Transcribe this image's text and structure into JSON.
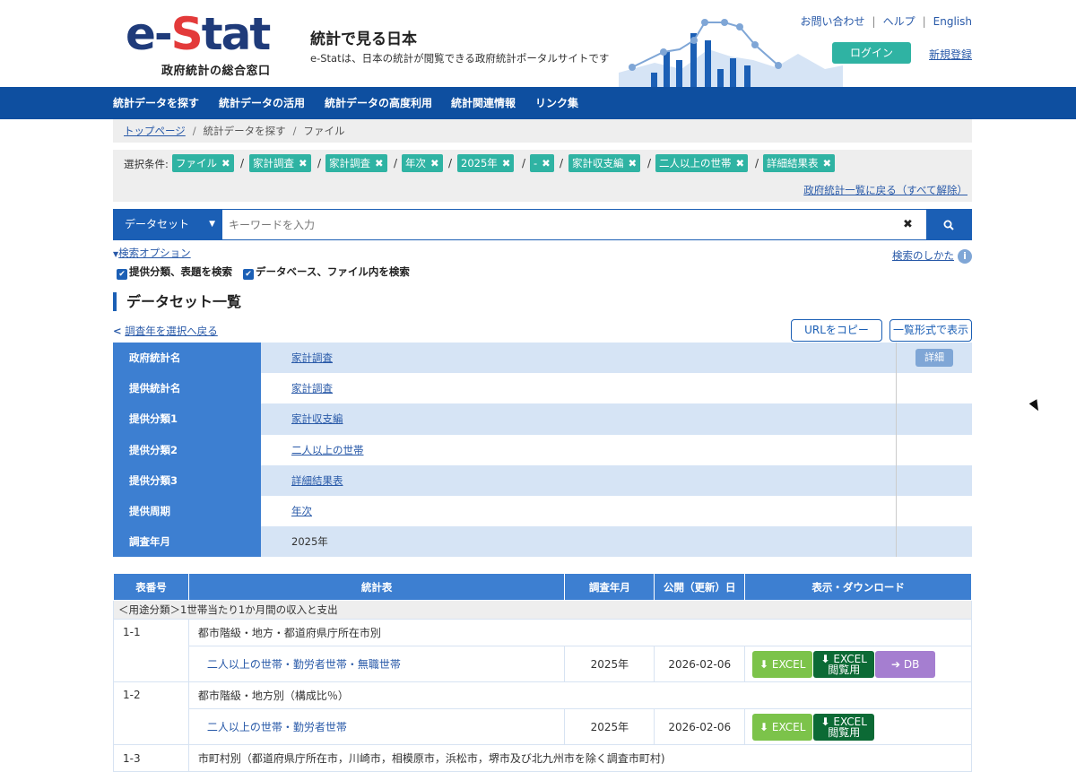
{
  "header": {
    "logo_word_1": "e-",
    "logo_word_2": "S",
    "logo_word_3": "tat",
    "logo_sub": "政府統計の総合窓口",
    "site_title": "統計で見る日本",
    "site_desc": "e-Statは、日本の統計が閲覧できる政府統計ポータルサイトです",
    "links": [
      "お問い合わせ",
      "ヘルプ",
      "English"
    ],
    "login": "ログイン",
    "register": "新規登録"
  },
  "nav": [
    "統計データを探す",
    "統計データの活用",
    "統計データの高度利用",
    "統計関連情報",
    "リンク集"
  ],
  "breadcrumb": [
    "トップページ",
    "統計データを探す",
    "ファイル"
  ],
  "conditions": {
    "label": "選択条件:",
    "chips": [
      "ファイル",
      "家計調査",
      "家計調査",
      "年次",
      "2025年",
      "-",
      "家計収支編",
      "二人以上の世帯",
      "詳細結果表"
    ],
    "back_all": "政府統計一覧に戻る（すべて解除）"
  },
  "search": {
    "scope": "データセット",
    "placeholder": "キーワードを入力"
  },
  "options": {
    "toggle": "検索オプション",
    "how": "検索のしかた",
    "check1": "提供分類、表題を検索",
    "check2": "データベース、ファイル内を検索"
  },
  "section_title": "データセット一覧",
  "back_year": "調査年を選択へ戻る",
  "buttons": {
    "copy_url": "URLをコピー",
    "list_view": "一覧形式で表示",
    "detail": "詳細"
  },
  "info": [
    {
      "k": "政府統計名",
      "v": "家計調査",
      "link": true
    },
    {
      "k": "提供統計名",
      "v": "家計調査",
      "link": true
    },
    {
      "k": "提供分類1",
      "v": "家計収支編",
      "link": true
    },
    {
      "k": "提供分類2",
      "v": "二人以上の世帯",
      "link": true
    },
    {
      "k": "提供分類3",
      "v": "詳細結果表",
      "link": true
    },
    {
      "k": "提供周期",
      "v": "年次",
      "link": true
    },
    {
      "k": "調査年月",
      "v": "2025年",
      "link": false
    }
  ],
  "table": {
    "headers": [
      "表番号",
      "統計表",
      "調査年月",
      "公開（更新）日",
      "表示・ダウンロード"
    ],
    "category": "＜用途分類＞1世帯当たり1か月間の収入と支出",
    "groups": [
      {
        "no": "1-1",
        "title": "都市階級・地方・都道府県庁所在市別",
        "item": "二人以上の世帯・勤労者世帯・無職世帯",
        "ym": "2025年",
        "date": "2026-02-06",
        "db": true
      },
      {
        "no": "1-2",
        "title": "都市階級・地方別（構成比％）",
        "item": "二人以上の世帯・勤労者世帯",
        "ym": "2025年",
        "date": "2026-02-06",
        "db": false
      },
      {
        "no": "1-3",
        "title": "市町村別（都道府県庁所在市，川崎市，相模原市，浜松市，堺市及び北九州市を除く調査市町村)"
      }
    ],
    "dl": {
      "excel": "EXCEL",
      "excel_view_1": "EXCEL",
      "excel_view_2": "閲覧用",
      "db": "DB"
    }
  }
}
